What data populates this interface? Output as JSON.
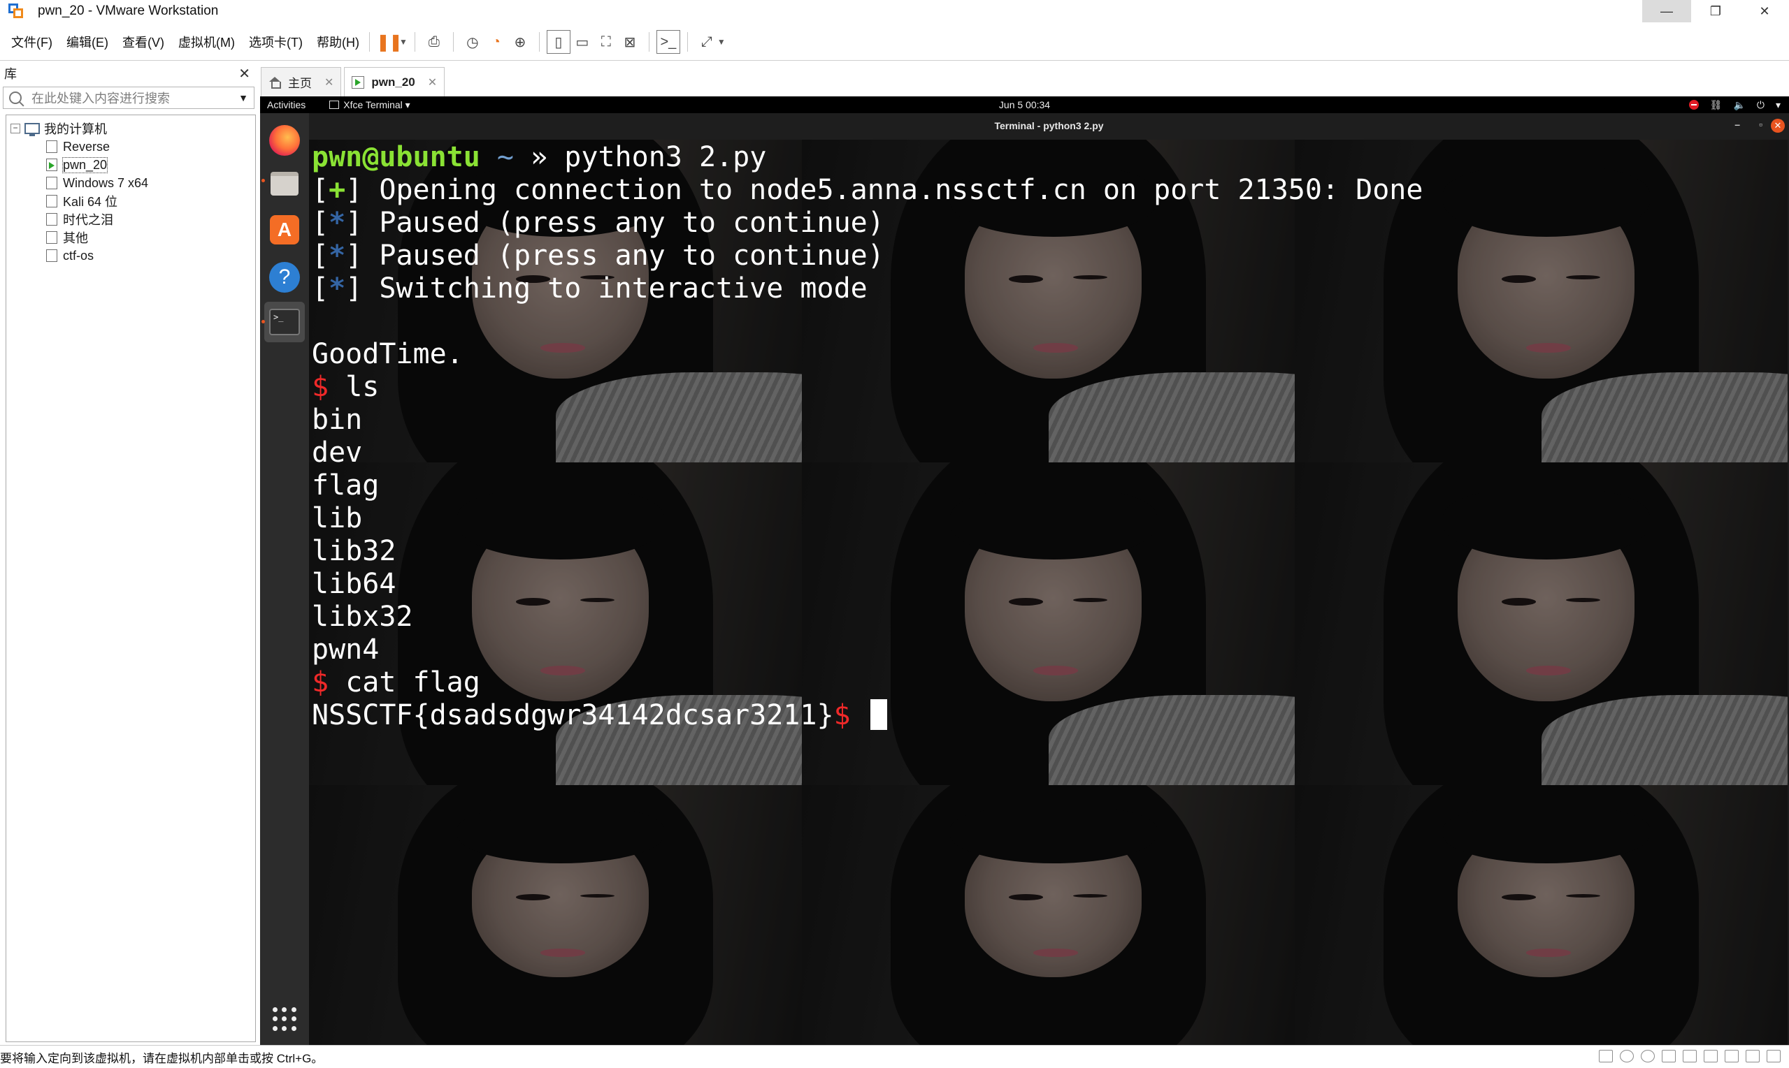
{
  "window": {
    "title": "pwn_20 - VMware Workstation",
    "controls": [
      "—",
      "❐",
      "✕"
    ]
  },
  "menu": [
    "文件(F)",
    "编辑(E)",
    "查看(V)",
    "虚拟机(M)",
    "选项卡(T)",
    "帮助(H)"
  ],
  "toolbar": {
    "icons": [
      "pause-icon",
      "send-ctrl-alt-del-icon",
      "snapshot-icon",
      "revert-snapshot-icon",
      "manage-snapshots-icon",
      "library-view-icon",
      "thumbnail-view-icon",
      "fullscreen-icon",
      "unity-icon",
      "console-view-icon",
      "stretch-icon"
    ]
  },
  "library": {
    "title": "库",
    "close": "✕",
    "search_placeholder": "在此处键入内容进行搜索",
    "root": "我的计算机",
    "items": [
      "Reverse",
      "pwn_20",
      "Windows 7 x64",
      "Kali 64 位",
      "时代之泪",
      "其他",
      "ctf-os"
    ],
    "selected": "pwn_20"
  },
  "tabs": [
    {
      "label": "主页",
      "active": false
    },
    {
      "label": "pwn_20",
      "active": true
    }
  ],
  "guest": {
    "topbar": {
      "activities": "Activities",
      "app": "Xfce Terminal ▾",
      "clock": "Jun 5  00:34"
    },
    "terminal": {
      "title": "Terminal - python3 2.py",
      "prompt_user": "pwn@ubuntu",
      "prompt_path": "~",
      "prompt_arrow": "»",
      "command": "python3 2.py",
      "lines": [
        {
          "tag": "+",
          "text": "Opening connection to node5.anna.nssctf.cn on port 21350: Done"
        },
        {
          "tag": "*",
          "text": "Paused (press any to continue)"
        },
        {
          "tag": "*",
          "text": "Paused (press any to continue)"
        },
        {
          "tag": "*",
          "text": "Switching to interactive mode"
        }
      ],
      "banner": "GoodTime.",
      "shell_prompt": "$",
      "cmd_ls": "ls",
      "ls_output": [
        "bin",
        "dev",
        "flag",
        "lib",
        "lib32",
        "lib64",
        "libx32",
        "pwn4"
      ],
      "cmd_cat": "cat flag",
      "flag": "NSSCTF{dsadsdgwr34142dcsar3211}"
    },
    "colors": {
      "prompt_green": "#8ae234",
      "path_blue": "#3465a4",
      "dollar_red": "#ef2929",
      "terminal_text": "#ffffff"
    }
  },
  "statusbar": {
    "message": "要将输入定向到该虚拟机，请在虚拟机内部单击或按 Ctrl+G。"
  }
}
